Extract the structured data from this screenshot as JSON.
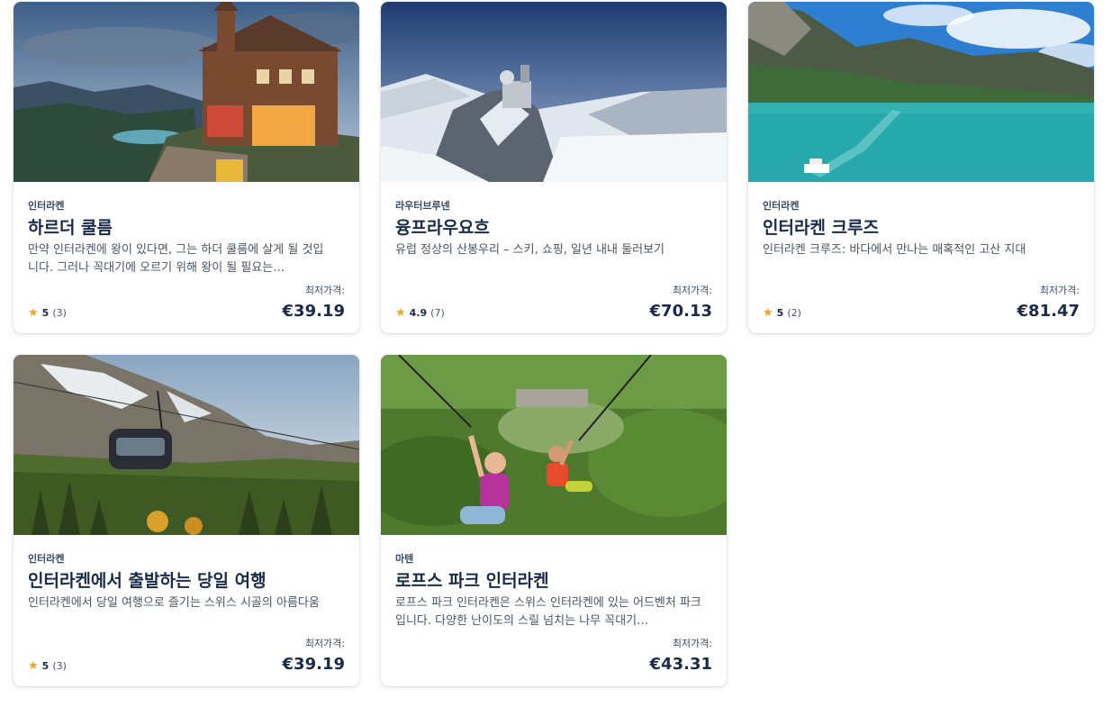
{
  "price_prefix": "최저가격:",
  "colors": {
    "star": "#f5a623",
    "text": "#1a2b49"
  },
  "cards": [
    {
      "location": "인터라켄",
      "title": "하르더 쿨름",
      "description": "만약 인터라켄에 왕이 있다면, 그는 하더 쿨름에 살게 될 것입니다. 그러나 꼭대기에 오르기 위해 왕이 될 필요는…",
      "score": "5",
      "reviews": "(3)",
      "price": "€39.19"
    },
    {
      "location": "라우터브루넨",
      "title": "융프라우요흐",
      "description": "유럽 정상의 산봉우리 – 스키, 쇼핑, 일년 내내 둘러보기",
      "score": "4.9",
      "reviews": "(7)",
      "price": "€70.13"
    },
    {
      "location": "인터라켄",
      "title": "인터라켄 크루즈",
      "description": "인터라켄 크루즈: 바다에서 만나는 매혹적인 고산 지대",
      "score": "5",
      "reviews": "(2)",
      "price": "€81.47"
    },
    {
      "location": "인터라켄",
      "title": "인터라켄에서 출발하는 당일 여행",
      "description": "인터라켄에서 당일 여행으로 즐기는 스위스 시골의 아름다움",
      "score": "5",
      "reviews": "(3)",
      "price": "€39.19"
    },
    {
      "location": "마텐",
      "title": "로프스 파크 인터라켄",
      "description": "로프스 파크 인터라켄은 스위스 인터라켄에 있는 어드벤처 파크입니다. 다양한 난이도의 스릴 넘치는 나무 꼭대기…",
      "price": "€43.31"
    }
  ]
}
